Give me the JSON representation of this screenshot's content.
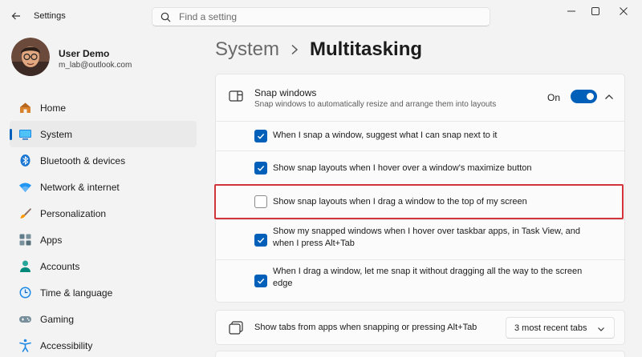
{
  "window": {
    "title": "Settings",
    "controls": [
      "minimize",
      "maximize",
      "close"
    ]
  },
  "search": {
    "placeholder": "Find a setting"
  },
  "profile": {
    "name": "User Demo",
    "email": "m_lab@outlook.com"
  },
  "sidebar": {
    "items": [
      {
        "label": "Home",
        "icon": "home-icon",
        "active": false
      },
      {
        "label": "System",
        "icon": "system-icon",
        "active": true
      },
      {
        "label": "Bluetooth & devices",
        "icon": "bluetooth-icon",
        "active": false
      },
      {
        "label": "Network & internet",
        "icon": "network-icon",
        "active": false
      },
      {
        "label": "Personalization",
        "icon": "brush-icon",
        "active": false
      },
      {
        "label": "Apps",
        "icon": "apps-icon",
        "active": false
      },
      {
        "label": "Accounts",
        "icon": "accounts-icon",
        "active": false
      },
      {
        "label": "Time & language",
        "icon": "time-language-icon",
        "active": false
      },
      {
        "label": "Gaming",
        "icon": "gaming-icon",
        "active": false
      },
      {
        "label": "Accessibility",
        "icon": "accessibility-icon",
        "active": false
      }
    ]
  },
  "breadcrumb": {
    "parent": "System",
    "current": "Multitasking"
  },
  "snap": {
    "title": "Snap windows",
    "description": "Snap windows to automatically resize and arrange them into layouts",
    "toggle_label": "On",
    "toggle_on": true,
    "options": [
      {
        "text": "When I snap a window, suggest what I can snap next to it",
        "checked": true
      },
      {
        "text": "Show snap layouts when I hover over a window's maximize button",
        "checked": true
      },
      {
        "text": "Show snap layouts when I drag a window to the top of my screen",
        "checked": false
      },
      {
        "text": "Show my snapped windows when I hover over taskbar apps, in Task View, and when I press Alt+Tab",
        "checked": true
      },
      {
        "text": "When I drag a window, let me snap it without dragging all the way to the screen edge",
        "checked": true
      }
    ]
  },
  "tabs_setting": {
    "label": "Show tabs from apps when snapping or pressing Alt+Tab",
    "selected": "3 most recent tabs"
  },
  "colors": {
    "accent": "#005fb8",
    "highlight": "#d1343b",
    "background": "#f3f3f3",
    "card": "#fbfbfb"
  }
}
